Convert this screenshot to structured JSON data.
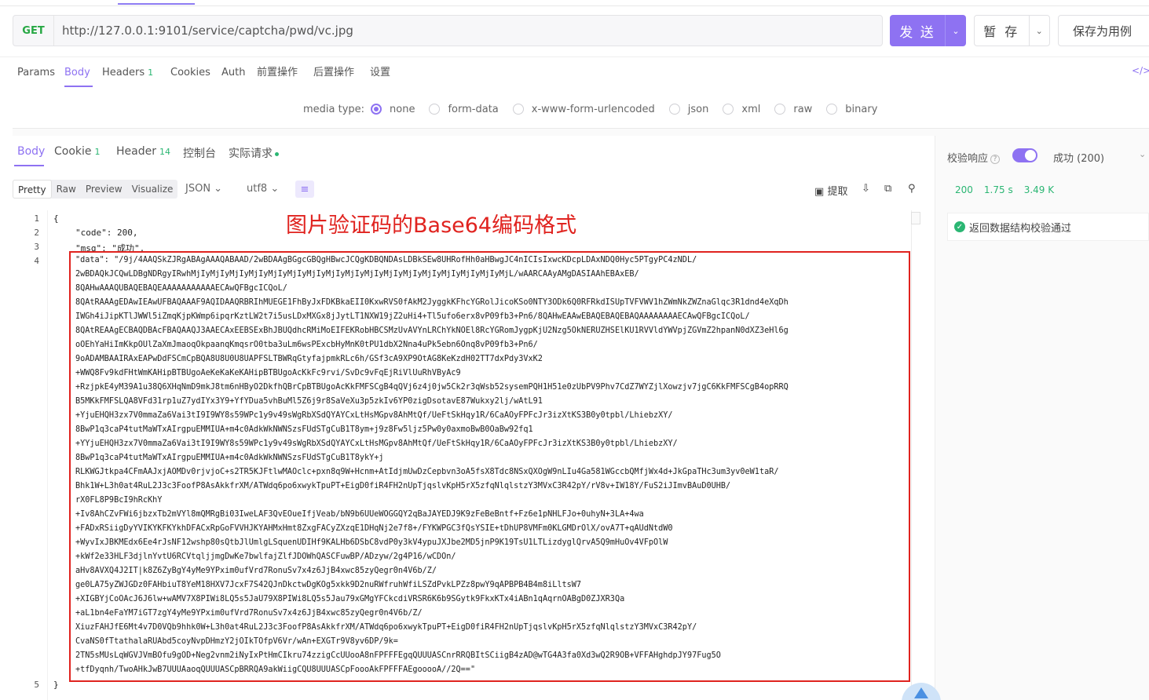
{
  "request": {
    "method": "GET",
    "url": "http://127.0.0.1:9101/service/captcha/pwd/vc.jpg",
    "send_label": "发 送",
    "save_label": "暂 存",
    "save_as_label": "保存为用例"
  },
  "request_tabs": [
    {
      "label": "Params"
    },
    {
      "label": "Body"
    },
    {
      "label": "Headers",
      "badge": "1"
    },
    {
      "label": "Cookies"
    },
    {
      "label": "Auth"
    },
    {
      "label": "前置操作"
    },
    {
      "label": "后置操作"
    },
    {
      "label": "设置"
    }
  ],
  "code_icon_label": "</>",
  "media": {
    "label": "media type:",
    "options": [
      "none",
      "form-data",
      "x-www-form-urlencoded",
      "json",
      "xml",
      "raw",
      "binary"
    ],
    "selected": "none"
  },
  "response_tabs": [
    {
      "label": "Body"
    },
    {
      "label": "Cookie",
      "badge": "1"
    },
    {
      "label": "Header",
      "badge": "14"
    },
    {
      "label": "控制台"
    },
    {
      "label": "实际请求"
    }
  ],
  "view_modes": [
    "Pretty",
    "Raw",
    "Preview",
    "Visualize"
  ],
  "format": "JSON ⌄",
  "encoding": "utf8 ⌄",
  "extract_label": "提取",
  "annotation": "图片验证码的Base64编码格式",
  "code": {
    "line_numbers": [
      "1",
      "2",
      "3",
      "4",
      "5"
    ],
    "open_brace": "{",
    "close_brace": "}",
    "code_line": "\"code\": 200,",
    "msg_line": "\"msg\": \"成功\",",
    "data_line_prefix": "\"data\": \"/9j/4AAQSkZJRgABAgAAAQABAAD/2wBDAAgBGgcGBQgHBwcJCQgKDBQNDAsLDBkSEw8UHRofHh0aHBwgJC4nICIsIxwcKDcpLDAxNDQ0Hyc5PTgyPC4zNDL/",
    "data_continuation": "2wBDAQkJCQwLDBgNDRgyIRwhMjIyMjIyMjIyMjIyMjIyMjIyMjIyMjIyMjIyMjIyMjIyMjIyMjIyMjIyMjIyMjIyMjL/wAARCAAyAMgDASIAAhEBAxEB/\n8QAHwAAAQUBAQEBAQEAAAAAAAAAAAECAwQFBgcICQoL/\n8QAtRAAAgEDAwIEAwUFBAQAAAF9AQIDAAQRBRIhMUEGE1FhByJxFDKBkaEII0KxwRVS0fAkM2JyggkKFhcYGRolJicoKSo0NTY3ODk6Q0RFRkdISUpTVFVWV1hZWmNkZWZnaGlqc3R1dnd4eXqDh\nIWGh4iJipKTlJWWl5iZmqKjpKWmp6ipqrKztLW2t7i5usLDxMXGx8jJytLT1NXW19jZ2uHi4+Tl5ufo6erx8vP09fb3+Pn6/8QAHwEAAwEBAQEBAQEBAQAAAAAAAAECAwQFBgcICQoL/\n8QAtREAAgECBAQDBAcFBAQAAQJ3AAECAxEEBSExBhJBUQdhcRMiMoEIFEKRobHBCSMzUvAVYnLRChYkNOEl8RcYGRomJygpKjU2Nzg5OkNERUZHSElKU1RVVldYWVpjZGVmZ2hpanN0dXZ3eHl6g\noOEhYaHiImKkpOUlZaXmJmaoqOkpaanqKmqsrO0tba3uLm6wsPExcbHyMnK0tPU1dbX2Nna4uPk5ebn6Onq8vP09fb3+Pn6/\n9oADAMBAAIRAxEAPwDdFSCmCpBQA8U8U0U8UAPFSLTBWRqGtyfajpmkRLc6h/GSf3cA9XP9OtAG8KeKzdH02TT7dxPdy3VxK2\n+WWQ8Fv9kdFHtWmKAHipBTBUgoAeKeKaKeKAHipBTBUgoAcKkFc9rvi/SvDc9vFqEjRiVlUuRhVByAc9\n+RzjpkE4yM39A1u38Q6XHqNmD9mkJ8tm6nHByO2DkfhQBrCpBTBUgoAcKkFMFSCgB4qQVj6z4j0jw5Ck2r3qWsb52sysemPQH1H51e0zUbPV9Phv7CdZ7WYZjlXowzjv7jgC6KkFMFSCgB4opRRQ\nB5MKkFMFSLQA8VFd31rp1uZ7ydIYx3Y9+YfYDua5vhBuMl5Z6j9r8SaVeXu3p5zkIv6YP0zigDsotavE87Wukxy2lj/wAtL91\n+YjuEHQH3zx7V0mmaZa6Vai3tI9I9WY8s59WPc1y9v49sWgRbXSdQYAYCxLtHsMGpv8AhMtQf/UeFtSkHqy1R/6CaAOyFPFcJr3izXtKS3B0y0tpbl/LhiebzXY/\n8BwP1q3caP4tutMaWTxAIrgpuEMMIUA+m4c0AdkWkNWNSzsFUdSTgCuB1T8ym+j9z8Fw5ljz5Pw0y0axmoBwB0OaBw92fq1\n+YYjuEHQH3zx7V0mmaZa6Vai3tI9I9WY8s59WPc1y9v49sWgRbXSdQYAYCxLtHsMGpv8AhMtQf/UeFtSkHqy1R/6CaAOyFPFcJr3izXtKS3B0y0tpbl/LhiebzXY/\n8BwP1q3caP4tutMaWTxAIrgpuEMMIUA+m4c0AdkWkNWNSzsFUdSTgCuB1T8ykY+j\nRLKWGJtkpa4CFmAAJxjAOMDv0rjvjoC+s2TR5KJFtlwMAOclc+pxn8q9W+Hcnm+AtIdjmUwDzCepbvn3oA5fsX8Tdc8NSxQXOgW9nLIu4Ga581WGccbQMfjWx4d+JkGpaTHc3um3yv0eW1taR/\nBhk1W+L3h0at4RuL2J3c3FoofP8AsAkkfrXM/ATWdq6po6xwykTpuPT+EigD0fiR4FH2nUpTjqslvKpH5rX5zfqNlqlstzY3MVxC3R42pY/rV8v+IW18Y/FuS2iJImvBAuD0UHB/\nrX0FL8P9BcI9hRcKhY\n+Iv8AhCZvFWi6jbzxTb2mVYl8mQMRgBi03IweLAF3QvEOueIfjVeab/bN9b6UUeWOGGQY2qBaJAYEDJ9K9zFeBeBntf+Fz6e1pNHLFJo+0uhyN+3LA+4wa\n+FADxRSiigDyYVIKYKFKYkhDFACxRpGoFVVHJKYAHMxHmt8ZxgFACyZXzqE1DHqNj2e7f8+/FYKWPGC3fQsYSIE+tDhUP8VMFm0KLGMDrOlX/ovA7T+qAUdNtdW0\n+WyvIxJBKMEdx6Ee4rJsNF12wshp80sQtbJlUmlgLSquenUDIHf9KALHb6DSbC8vdP0y3kV4ypuJXJbe2MD5jnP9K19TsU1LTLizdyglQrvA5Q9mHuOv4VFpOlW\n+kWf2e33HLF3djlnYvtU6RCVtqljjmgDwKe7bwlfajZlfJDOWhQASCFuwBP/ADzyw/2g4P16/wCDOn/\naHv8AVXQ4J2IT|k8Z6ZyBgY4yMe9YPxim0ufVrd7RonuSv7x4z6JjB4xwc85zyQegr0n4V6b/Z/\nge0LA75yZWJGDz0FAHbiuT8YeM18HXV7JcxF7S42QJnDkctwDgKOg5xkk9D2nuRWfruhWfiLSZdPvkLPZz8pwY9qAPBPB4B4m8iLltsW7\n+XIGBYjCoOAcJ6J6lw+wAMV7X8PIWi8LQ5s5JaU79X8PIWi8LQ5s5Jau79xGMgYFCkcdiVRSR6K6b9SGytk9FkxKTx4iABn1qAqrnOABgD0ZJXR3Qa\n+aL1bn4eFaYM7iGT7zgY4yMe9YPxim0ufVrd7RonuSv7x4z6JjB4xwc85zyQegr0n4V6b/Z/\nXiuzFAHJfE6Mt4v7D0VQb9hhk0W+L3h0at4RuL2J3c3FoofP8AsAkkfrXM/ATWdq6po6xwykTpuPT+EigD0fiR4FH2nUpTjqslvKpH5rX5zfqNlqlstzY3MVxC3R42pY/\nCvaNS0fTtathalaRUAbd5coyNvpDHmzY2jOIkTOfpV6Vr/wAn+EXGTr9V8yv6DP/9k=\n2TN5sMUsLqWGVJVmBOfu9gOD+Neg2vnm2iNyIxPtHmCIkru74zzigCcUUooA8nFPFFFEgqQUUUASCnrRRQBItSCiigB4zAD@wTG4A3fa0Xd3wQ2R9OB+VFFAHghdpJY97Fug5O\n+tfDyqnh/TwoAHkJwB7UUUAaoqQUUUASCpBRRQA9akWiigCQU8UUUASCpFoooAkFPFFFAEgooooA//2Q==\""
  },
  "right_panel": {
    "validate_label": "校验响应",
    "help": "?",
    "success_label": "成功 (200)",
    "status": "200",
    "time": "1.75 s",
    "size": "3.49 K",
    "validation_result": "返回数据结构校验通过"
  }
}
